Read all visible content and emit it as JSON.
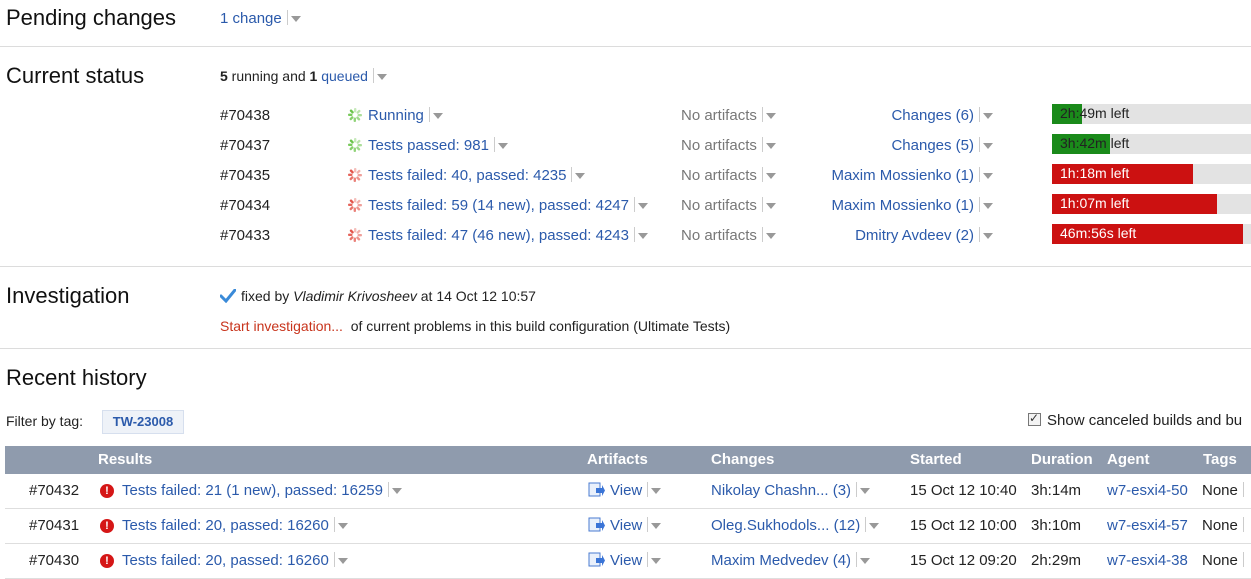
{
  "pending": {
    "title": "Pending changes",
    "link": "1 change"
  },
  "current": {
    "title": "Current status",
    "summary_running_count": "5",
    "summary_running_text": " running and ",
    "summary_queued_count": "1",
    "summary_queued_link": "queued",
    "builds": [
      {
        "id": "#70438",
        "status": "Running",
        "state": "running",
        "artifacts": "No artifacts",
        "changes": "Changes (6)",
        "progress_text": "2h:49m left",
        "progress": 0.15,
        "bar_color": "#1a8a1a"
      },
      {
        "id": "#70437",
        "status": "Tests passed: 981",
        "state": "passed",
        "artifacts": "No artifacts",
        "changes": "Changes (5)",
        "progress_text": "3h:42m left",
        "progress": 0.29,
        "bar_color": "#1a8a1a"
      },
      {
        "id": "#70435",
        "status": "Tests failed: 40, passed: 4235",
        "state": "failed",
        "artifacts": "No artifacts",
        "changes": "Maxim Mossienko (1)",
        "progress_text": "1h:18m left",
        "progress": 0.71,
        "bar_color": "#cc1111"
      },
      {
        "id": "#70434",
        "status": "Tests failed: 59 (14 new), passed: 4247",
        "state": "failed",
        "artifacts": "No artifacts",
        "changes": "Maxim Mossienko (1)",
        "progress_text": "1h:07m left",
        "progress": 0.83,
        "bar_color": "#cc1111"
      },
      {
        "id": "#70433",
        "status": "Tests failed: 47 (46 new), passed: 4243",
        "state": "failed",
        "artifacts": "No artifacts",
        "changes": "Dmitry Avdeev (2)",
        "progress_text": "46m:56s left",
        "progress": 0.96,
        "bar_color": "#cc1111"
      }
    ]
  },
  "investigation": {
    "title": "Investigation",
    "fixed_by_prefix": "fixed by ",
    "fixed_by_name": "Vladimir Krivosheev",
    "fixed_by_suffix": " at 14 Oct 12 10:57",
    "start_link": "Start investigation...",
    "start_rest": "of current problems in this build configuration (Ultimate Tests)"
  },
  "history": {
    "title": "Recent history",
    "filter_label": "Filter by tag:",
    "tag": "TW-23008",
    "show_canceled_label": "Show canceled builds and bu",
    "columns": {
      "results": "Results",
      "artifacts": "Artifacts",
      "changes": "Changes",
      "started": "Started",
      "duration": "Duration",
      "agent": "Agent",
      "tags": "Tags"
    },
    "rows": [
      {
        "id": "#70432",
        "result": "Tests failed: 21 (1 new), passed: 16259",
        "artifacts": "View",
        "changes": "Nikolay Chashn... (3)",
        "started": "15 Oct 12 10:40",
        "duration": "3h:14m",
        "agent": "w7-esxi4-50",
        "tags": "None"
      },
      {
        "id": "#70431",
        "result": "Tests failed: 20, passed: 16260",
        "artifacts": "View",
        "changes": "Oleg.Sukhodols... (12)",
        "started": "15 Oct 12 10:00",
        "duration": "3h:10m",
        "agent": "w7-esxi4-57",
        "tags": "None"
      },
      {
        "id": "#70430",
        "result": "Tests failed: 20, passed: 16260",
        "artifacts": "View",
        "changes": "Maxim Medvedev (4)",
        "started": "15 Oct 12 09:20",
        "duration": "2h:29m",
        "agent": "w7-esxi4-38",
        "tags": "None"
      }
    ]
  }
}
